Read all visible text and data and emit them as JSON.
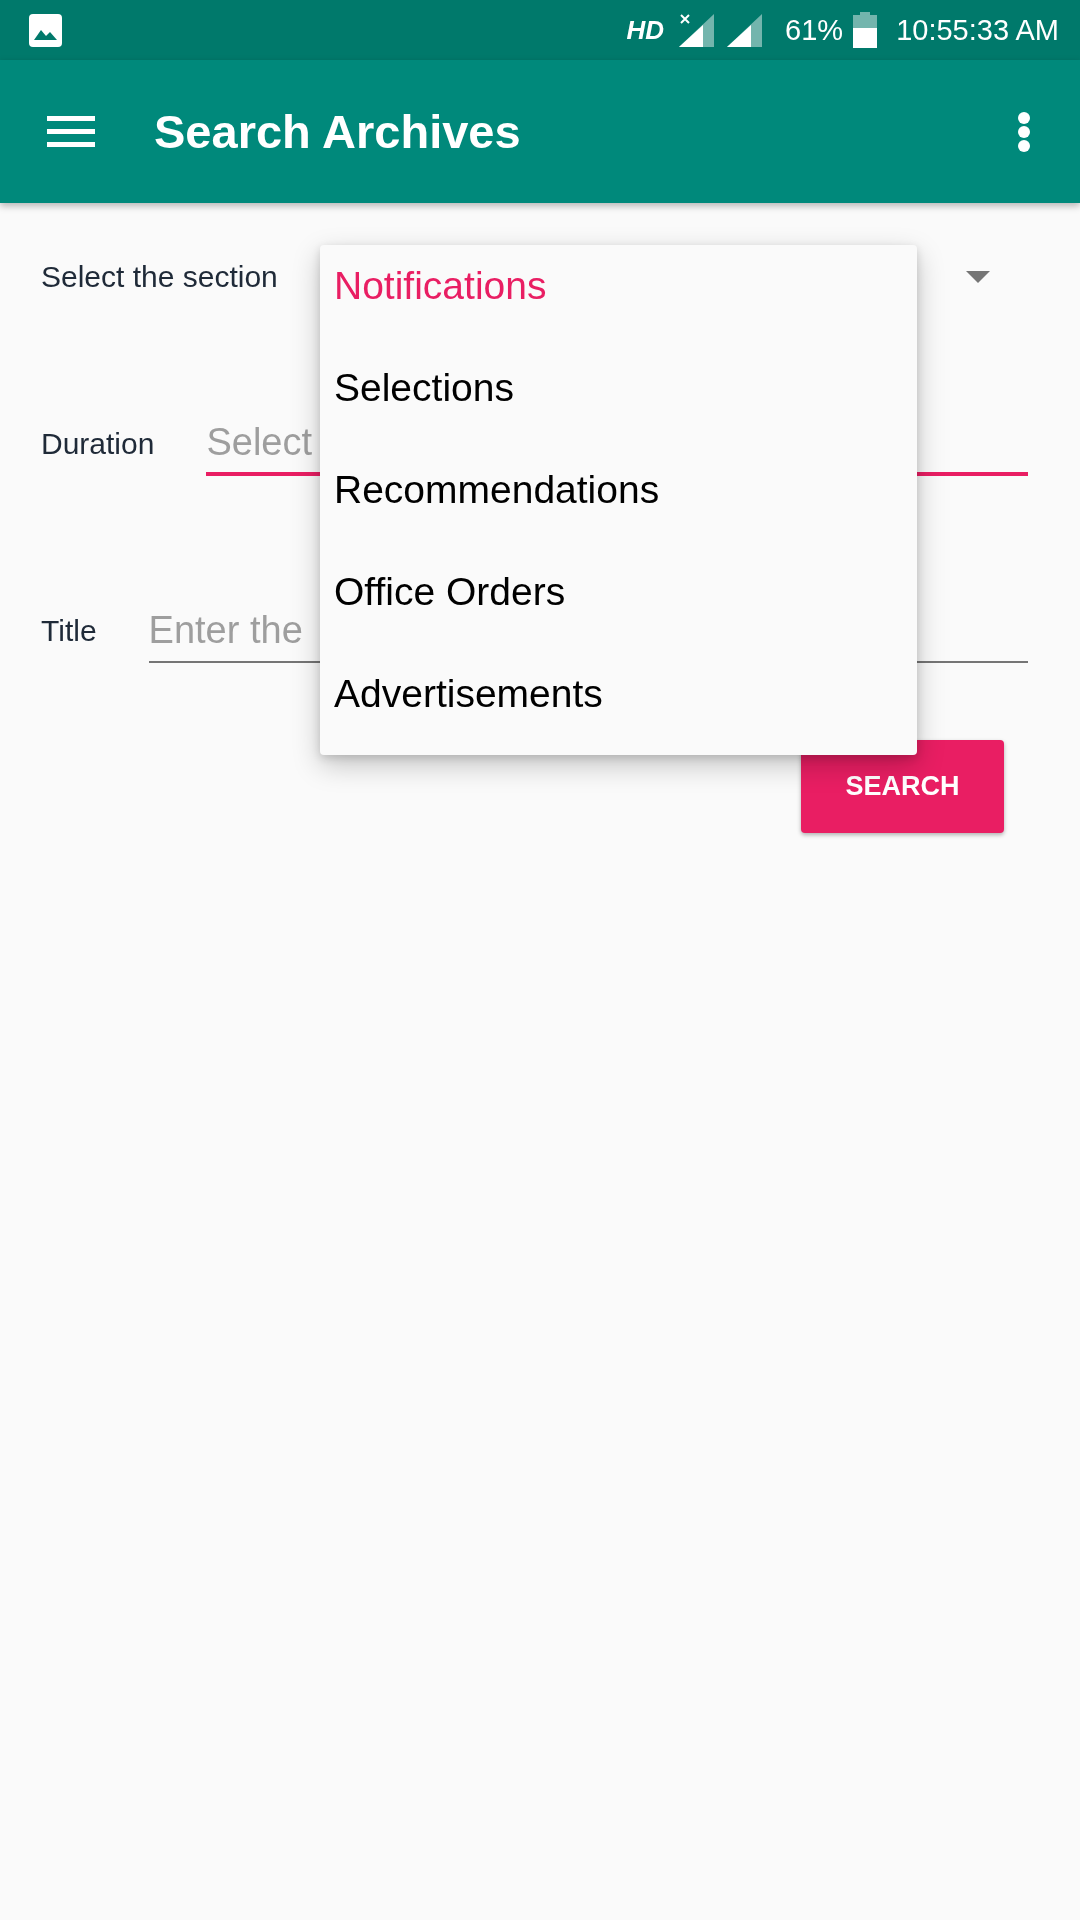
{
  "status_bar": {
    "network_type": "HD",
    "battery": "61%",
    "time": "10:55:33 AM"
  },
  "app_bar": {
    "title": "Search Archives"
  },
  "form": {
    "section": {
      "label": "Select the section"
    },
    "duration": {
      "label": "Duration",
      "placeholder": "Select",
      "focused": true
    },
    "title": {
      "label": "Title",
      "placeholder": "Enter the",
      "focused": false
    },
    "search_button": "SEARCH"
  },
  "dropdown_menu": {
    "items": [
      {
        "label": "Notifications",
        "selected": true
      },
      {
        "label": "Selections",
        "selected": false
      },
      {
        "label": "Recommendations",
        "selected": false
      },
      {
        "label": "Office Orders",
        "selected": false
      },
      {
        "label": "Advertisements",
        "selected": false
      }
    ]
  }
}
